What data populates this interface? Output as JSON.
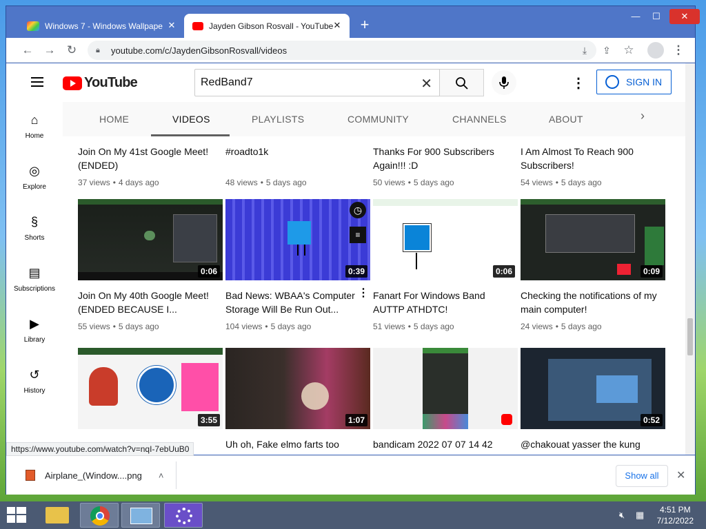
{
  "browser": {
    "tabs": [
      {
        "title": "Windows 7 - Windows Wallpape",
        "active": false
      },
      {
        "title": "Jayden Gibson Rosvall - YouTube",
        "active": true
      }
    ],
    "new_tab_label": "+",
    "url": "youtube.com/c/JaydenGibsonRosvall/videos",
    "window_controls": {
      "minimize": "—",
      "maximize": "☐",
      "close": "✕"
    }
  },
  "youtube": {
    "logo_text": "YouTube",
    "search_value": "RedBand7",
    "signin_label": "SIGN IN",
    "guide": [
      {
        "label": "Home",
        "icon": "home-icon"
      },
      {
        "label": "Explore",
        "icon": "explore-icon"
      },
      {
        "label": "Shorts",
        "icon": "shorts-icon"
      },
      {
        "label": "Subscriptions",
        "icon": "subscriptions-icon"
      },
      {
        "label": "Library",
        "icon": "library-icon"
      },
      {
        "label": "History",
        "icon": "history-icon"
      }
    ],
    "channel_tabs": [
      "HOME",
      "VIDEOS",
      "PLAYLISTS",
      "COMMUNITY",
      "CHANNELS",
      "ABOUT"
    ],
    "active_tab": "VIDEOS",
    "rows": [
      [
        {
          "title": "Join On My 41st Google Meet! (ENDED)",
          "views": "37 views",
          "age": "4 days ago"
        },
        {
          "title": "#roadto1k",
          "views": "48 views",
          "age": "5 days ago"
        },
        {
          "title": "Thanks For 900 Subscribers Again!!! :D",
          "views": "50 views",
          "age": "5 days ago"
        },
        {
          "title": "I Am Almost To Reach 900 Subscribers!",
          "views": "54 views",
          "age": "5 days ago"
        }
      ],
      [
        {
          "title": "Join On My 40th Google Meet! (ENDED BECAUSE I...",
          "views": "55 views",
          "age": "5 days ago",
          "duration": "0:06"
        },
        {
          "title": "Bad News: WBAA's Computer Storage Will Be Run Out...",
          "views": "104 views",
          "age": "5 days ago",
          "duration": "0:39"
        },
        {
          "title": "Fanart For Windows Band AUTTP ATHDTC!",
          "views": "51 views",
          "age": "5 days ago",
          "duration": "0:06"
        },
        {
          "title": "Checking the notifications of my main computer!",
          "views": "24 views",
          "age": "5 days ago",
          "duration": "0:09"
        }
      ],
      [
        {
          "title": "",
          "duration": "3:55"
        },
        {
          "title": "Uh oh, Fake elmo farts too",
          "duration": "1:07"
        },
        {
          "title": "bandicam 2022 07 07 14 42",
          "duration": ""
        },
        {
          "title": "@chakouat yasser the kung",
          "duration": "0:52"
        }
      ]
    ]
  },
  "status_url": "https://www.youtube.com/watch?v=nqI-7ebUuB0",
  "downloads": {
    "file_name": "Airplane_(Window....png",
    "show_all_label": "Show all"
  },
  "taskbar": {
    "time": "4:51 PM",
    "date": "7/12/2022"
  },
  "colors": {
    "yt_red": "#ff0000",
    "link_blue": "#065fd4",
    "window_frame": "#4f76c8"
  }
}
